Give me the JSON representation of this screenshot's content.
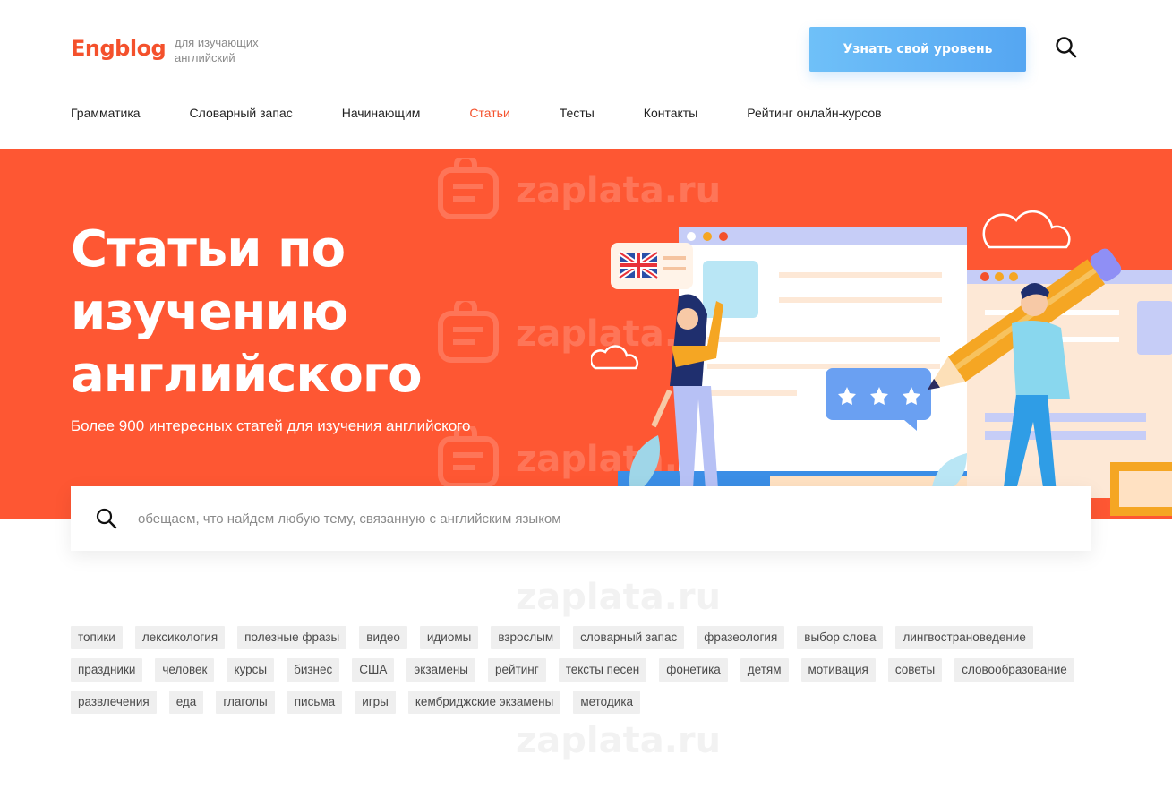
{
  "header": {
    "logo": "Engblog",
    "tagline": "для изучающих английский",
    "cta_label": "Узнать свой уровень"
  },
  "nav": {
    "items": [
      {
        "label": "Грамматика",
        "active": false
      },
      {
        "label": "Словарный запас",
        "active": false
      },
      {
        "label": "Начинающим",
        "active": false
      },
      {
        "label": "Статьи",
        "active": true
      },
      {
        "label": "Тесты",
        "active": false
      },
      {
        "label": "Контакты",
        "active": false
      },
      {
        "label": "Рейтинг онлайн-курсов",
        "active": false
      }
    ]
  },
  "hero": {
    "title": "Статьи по изучению английского",
    "subtitle": "Более 900 интересных статей для изучения английского"
  },
  "search": {
    "placeholder": "обещаем, что найдем любую тему, связанную с английским языком",
    "value": ""
  },
  "tags": [
    "топики",
    "лексикология",
    "полезные фразы",
    "видео",
    "идиомы",
    "взрослым",
    "словарный запас",
    "фразеология",
    "выбор слова",
    "лингвострановедение",
    "праздники",
    "человек",
    "курсы",
    "бизнес",
    "США",
    "экзамены",
    "рейтинг",
    "тексты песен",
    "фонетика",
    "детям",
    "мотивация",
    "советы",
    "словообразование",
    "развлечения",
    "еда",
    "глаголы",
    "письма",
    "игры",
    "кембриджские экзамены",
    "методика"
  ],
  "watermark": "zaplata.ru",
  "colors": {
    "brand": "#f4512c",
    "hero_bg": "#fe5733",
    "cta_start": "#6fc0f8",
    "cta_end": "#55a6f2",
    "tag_bg": "#efefef"
  },
  "icons": [
    "search-icon",
    "uk-flag-icon",
    "star-icon",
    "cloud-icon"
  ]
}
